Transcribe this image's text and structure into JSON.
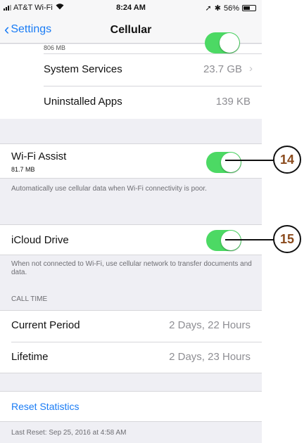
{
  "status_bar": {
    "carrier": "AT&T Wi-Fi",
    "wifi_icon": "wifi-icon",
    "time": "8:24 AM",
    "location_icon": "➚",
    "bluetooth_icon": "✱",
    "battery_text": "56%",
    "battery_level": 0.56
  },
  "nav": {
    "back_label": "Settings",
    "title": "Cellular"
  },
  "apps": {
    "partial_sub": "806 MB",
    "items": [
      {
        "label": "System Services",
        "value": "23.7 GB",
        "chevron": "›"
      },
      {
        "label": "Uninstalled Apps",
        "value": "139 KB"
      }
    ]
  },
  "wifi_assist": {
    "label": "Wi-Fi Assist",
    "sub": "81.7 MB",
    "on": true,
    "footer": "Automatically use cellular data when Wi-Fi connectivity is poor."
  },
  "icloud_drive": {
    "label": "iCloud Drive",
    "on": true,
    "footer": "When not connected to Wi-Fi, use cellular network to transfer documents and data."
  },
  "call_time": {
    "header": "CALL TIME",
    "rows": [
      {
        "label": "Current Period",
        "value": "2 Days, 22 Hours"
      },
      {
        "label": "Lifetime",
        "value": "2 Days, 23 Hours"
      }
    ]
  },
  "reset": {
    "label": "Reset Statistics",
    "last_reset": "Last Reset: Sep 25, 2016 at 4:58 AM"
  },
  "callouts": [
    "14",
    "15"
  ],
  "colors": {
    "accent": "#1a7cf5",
    "toggle_on": "#4cd964",
    "callout_number": "#8a4a1c"
  }
}
